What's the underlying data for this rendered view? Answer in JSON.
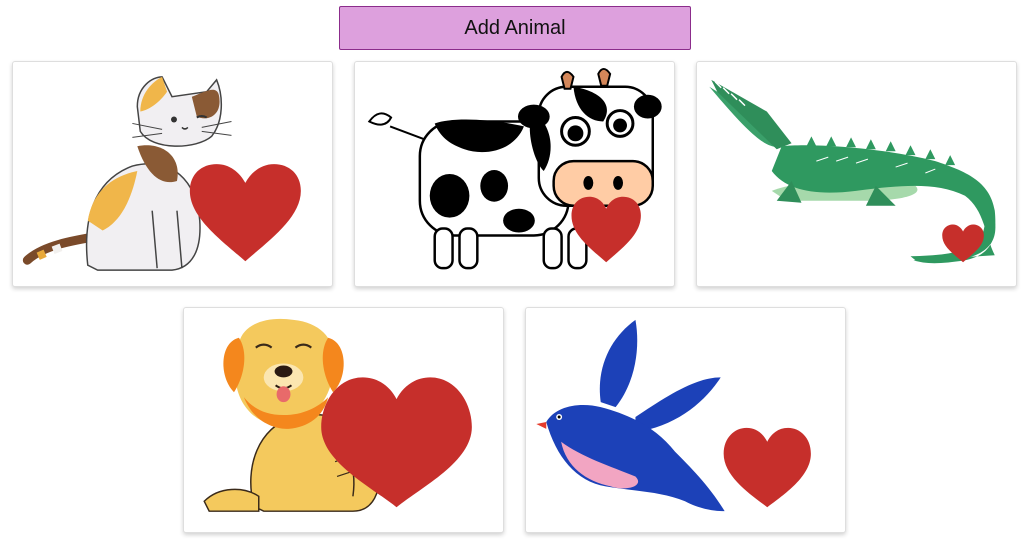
{
  "toolbar": {
    "add_label": "Add Animal"
  },
  "colors": {
    "button_bg": "#dda0dd",
    "button_border": "#8b2c8b",
    "heart": "#c62f2b"
  },
  "cards": [
    {
      "animal": "cat",
      "liked": true
    },
    {
      "animal": "cow",
      "liked": true
    },
    {
      "animal": "crocodile",
      "liked": true
    },
    {
      "animal": "dog",
      "liked": true
    },
    {
      "animal": "bird",
      "liked": true
    }
  ]
}
